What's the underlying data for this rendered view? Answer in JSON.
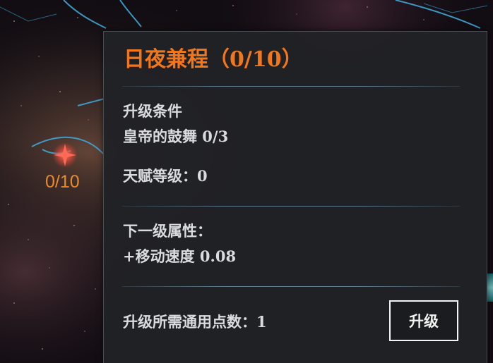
{
  "skill_node": {
    "progress_text": "0/10"
  },
  "tooltip": {
    "title": "日夜兼程（0/10）",
    "condition_header": "升级条件",
    "condition_item": "皇帝的鼓舞  0/3",
    "talent_level": "天赋等级：0",
    "next_level_header": "下一级属性：",
    "next_level_effect": "+移动速度  0.08",
    "required_points": "升级所需通用点数：1",
    "upgrade_label": "升级"
  },
  "colors": {
    "title": "#f2771b",
    "node_count": "#e98a2b",
    "text": "#d9dbdf",
    "panel_bg": "#212226",
    "constellation_line": "#3fa6d6"
  }
}
